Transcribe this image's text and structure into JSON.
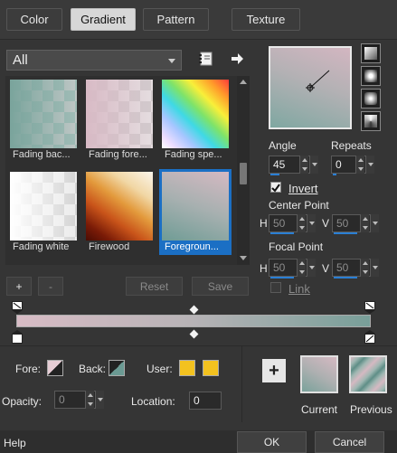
{
  "tabs": [
    {
      "label": "Color"
    },
    {
      "label": "Gradient",
      "active": true
    },
    {
      "label": "Pattern"
    },
    {
      "label": "Texture"
    }
  ],
  "preset_filter": "All",
  "presets": [
    {
      "name": "Fading bac..."
    },
    {
      "name": "Fading fore..."
    },
    {
      "name": "Fading spe..."
    },
    {
      "name": "Fading white"
    },
    {
      "name": "Firewood"
    },
    {
      "name": "Foregroun...",
      "selected": true
    }
  ],
  "preset_buttons": {
    "add": "+",
    "remove": "-",
    "reset": "Reset",
    "save": "Save"
  },
  "angle": {
    "label": "Angle",
    "value": "45"
  },
  "repeats": {
    "label": "Repeats",
    "value": "0"
  },
  "invert": {
    "label": "Invert",
    "checked": true
  },
  "center_point": {
    "label": "Center Point",
    "h_label": "H",
    "h": "50",
    "v_label": "V",
    "v": "50"
  },
  "focal_point": {
    "label": "Focal Point",
    "h_label": "H",
    "h": "50",
    "v_label": "V",
    "v": "50"
  },
  "link": {
    "label": "Link",
    "checked": false
  },
  "stops": {
    "fore_label": "Fore:",
    "back_label": "Back:",
    "user_label": "User:",
    "opacity_label": "Opacity:",
    "opacity": "0",
    "location_label": "Location:",
    "location": "0",
    "user_color": "#f3c21f"
  },
  "color_preview": {
    "current": "Current",
    "previous": "Previous",
    "add": "+"
  },
  "footer": {
    "help": "Help",
    "ok": "OK",
    "cancel": "Cancel"
  },
  "colors": {
    "gradient_start": "#d8bcc5",
    "gradient_mid": "#b7b3b6",
    "gradient_end": "#789f99",
    "selection": "#1b6fc4"
  }
}
